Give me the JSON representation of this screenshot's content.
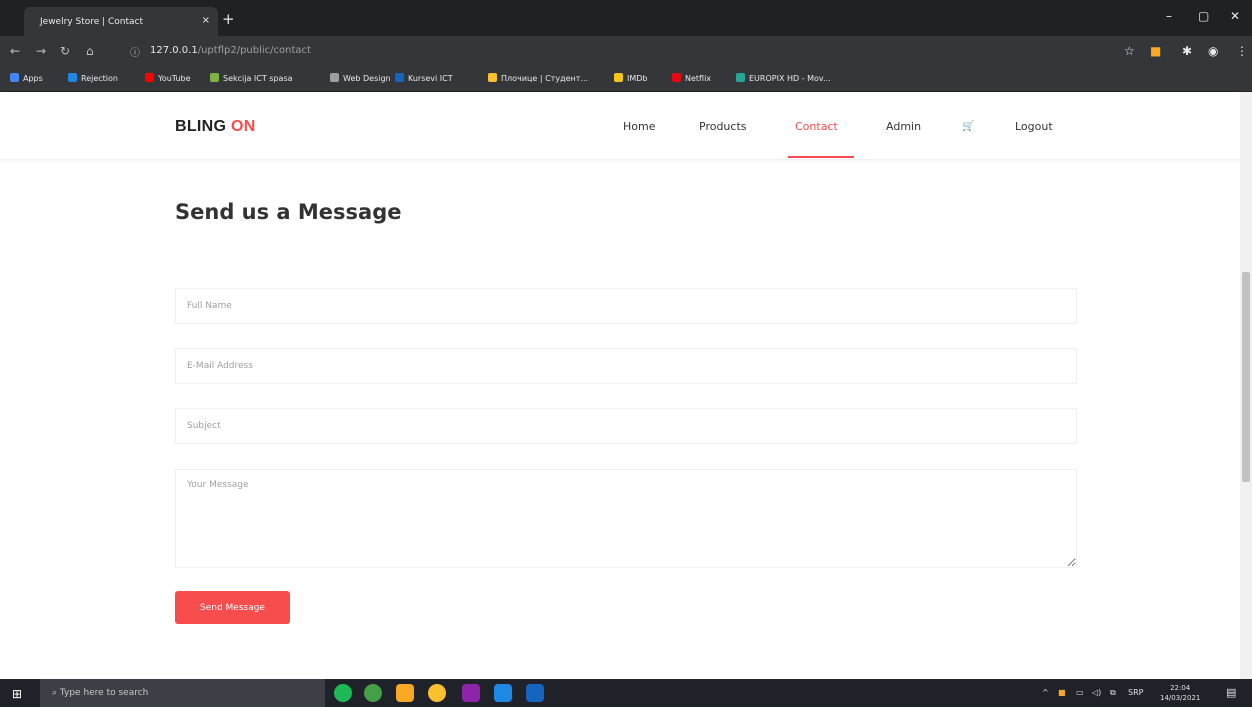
{
  "browser": {
    "tab_title": "Jewelry Store | Contact",
    "tab_close": "×",
    "new_tab": "+",
    "url_host": "127.0.0.1",
    "url_path": "/uptflp2/public/contact",
    "win_min": "–",
    "win_max": "▢",
    "win_close": "✕",
    "bookmarks": [
      {
        "label": "Apps",
        "color": "#4285f4"
      },
      {
        "label": "Rejection",
        "color": "#1e88e5"
      },
      {
        "label": "YouTube",
        "color": "#ff0000"
      },
      {
        "label": "Sekcija ICT spasa",
        "color": "#7cb342"
      },
      {
        "label": "Web Design",
        "color": "#9e9e9e"
      },
      {
        "label": "Kursevi ICT",
        "color": "#1565c0"
      },
      {
        "label": "Плочице | Студент...",
        "color": "#fbc02d"
      },
      {
        "label": "IMDb",
        "color": "#f5c518"
      },
      {
        "label": "Netflix",
        "color": "#e50914"
      },
      {
        "label": "EUROPIX HD - Mov...",
        "color": "#26a69a"
      }
    ]
  },
  "header": {
    "logo_main": "BLING ",
    "logo_accent": "ON",
    "nav": {
      "home": "Home",
      "products": "Products",
      "contact": "Contact",
      "admin": "Admin",
      "cart_icon": "🛒",
      "logout": "Logout"
    }
  },
  "form": {
    "title": "Send us a Message",
    "full_name_placeholder": "Full Name",
    "email_placeholder": "E-Mail Address",
    "subject_placeholder": "Subject",
    "message_placeholder": "Your Message",
    "submit_label": "Send Message"
  },
  "taskbar": {
    "search_placeholder": "Type here to search",
    "tray_lang": "SRP",
    "time": "22:04",
    "date": "14/03/2021"
  },
  "colors": {
    "accent": "#f74d4d"
  }
}
